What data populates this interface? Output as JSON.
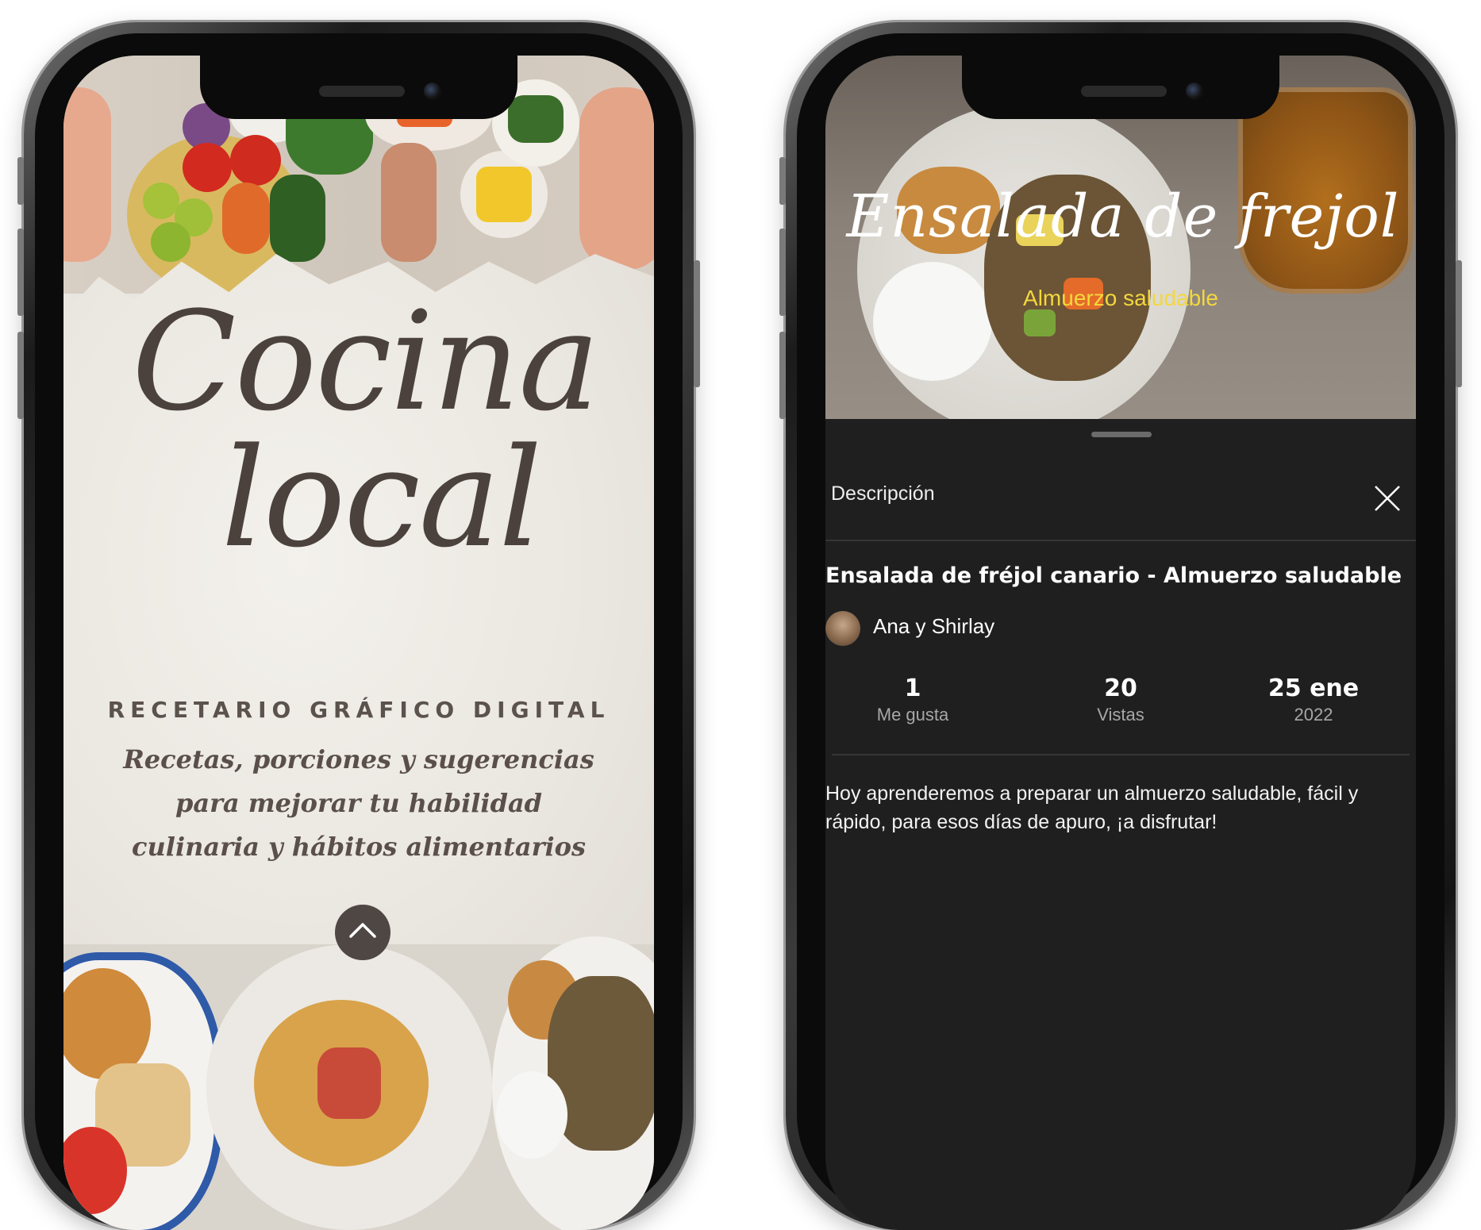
{
  "left_screen": {
    "title_line1": "Cocina",
    "title_line2": "local",
    "subtitle": "RECETARIO GRÁFICO DIGITAL",
    "tagline_line1": "Recetas, porciones y sugerencias",
    "tagline_line2": "para mejorar tu habilidad",
    "tagline_line3": "culinaria y hábitos alimentarios",
    "up_button_icon": "chevron-up-icon"
  },
  "right_screen": {
    "hero_title": "Ensalada de frejol",
    "hero_subtitle": "Almuerzo saludable",
    "sheet_label": "Descripción",
    "close_icon": "close-icon",
    "video_title": "Ensalada de fréjol canario - Almuerzo saludable",
    "author": "Ana y Shirlay",
    "stats": [
      {
        "value": "1",
        "label": "Me gusta"
      },
      {
        "value": "20",
        "label": "Vistas"
      },
      {
        "value": "25 ene",
        "label": "2022"
      }
    ],
    "description": "Hoy aprenderemos a preparar un almuerzo saludable, fácil y rápido, para esos días de apuro, ¡a disfrutar!"
  },
  "colors": {
    "accent_yellow": "#f3d83c",
    "sheet_background": "#1f1f1f",
    "paper_text": "#4b413d"
  }
}
